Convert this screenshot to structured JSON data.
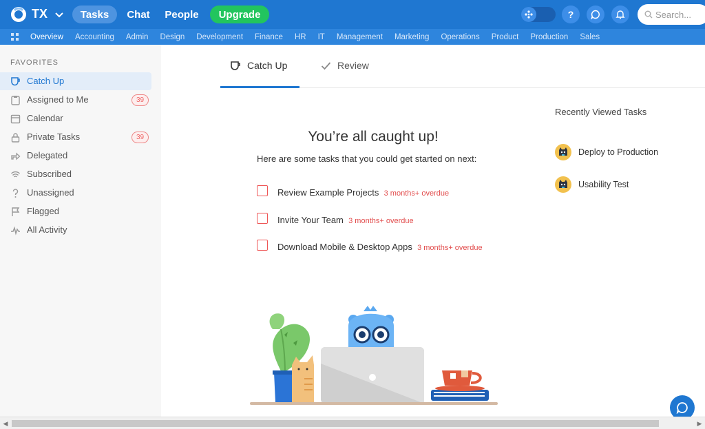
{
  "topbar": {
    "workspace": "TX",
    "nav": [
      "Tasks",
      "Chat",
      "People"
    ],
    "upgrade": "Upgrade",
    "help_glyph": "?",
    "search_placeholder": "Search..."
  },
  "subnav": {
    "items": [
      "Overview",
      "Accounting",
      "Admin",
      "Design",
      "Development",
      "Finance",
      "HR",
      "IT",
      "Management",
      "Marketing",
      "Operations",
      "Product",
      "Production",
      "Sales"
    ],
    "active": "Overview"
  },
  "sidebar": {
    "section_title": "FAVORITES",
    "items": [
      {
        "label": "Catch Up",
        "icon": "cup-icon",
        "badge": ""
      },
      {
        "label": "Assigned to Me",
        "icon": "clipboard-icon",
        "badge": "39"
      },
      {
        "label": "Calendar",
        "icon": "calendar-icon",
        "badge": ""
      },
      {
        "label": "Private Tasks",
        "icon": "lock-icon",
        "badge": "39"
      },
      {
        "label": "Delegated",
        "icon": "delegate-icon",
        "badge": ""
      },
      {
        "label": "Subscribed",
        "icon": "wifi-icon",
        "badge": ""
      },
      {
        "label": "Unassigned",
        "icon": "question-icon",
        "badge": ""
      },
      {
        "label": "Flagged",
        "icon": "flag-icon",
        "badge": ""
      },
      {
        "label": "All Activity",
        "icon": "activity-icon",
        "badge": ""
      }
    ]
  },
  "tabs": [
    {
      "label": "Catch Up",
      "icon": "cup-icon"
    },
    {
      "label": "Review",
      "icon": "check-icon"
    }
  ],
  "main": {
    "headline": "You’re all caught up!",
    "subline": "Here are some tasks that you could get started on next:",
    "tasks": [
      {
        "title": "Review Example Projects",
        "status": "3 months+ overdue"
      },
      {
        "title": "Invite Your Team",
        "status": "3 months+ overdue"
      },
      {
        "title": "Download Mobile & Desktop Apps",
        "status": "3 months+ overdue"
      }
    ]
  },
  "recent": {
    "title": "Recently Viewed Tasks",
    "items": [
      "Deploy to Production",
      "Usability Test"
    ]
  },
  "colors": {
    "brand": "#1f77d1",
    "upgrade": "#22c55e",
    "overdue": "#e24e4e"
  }
}
